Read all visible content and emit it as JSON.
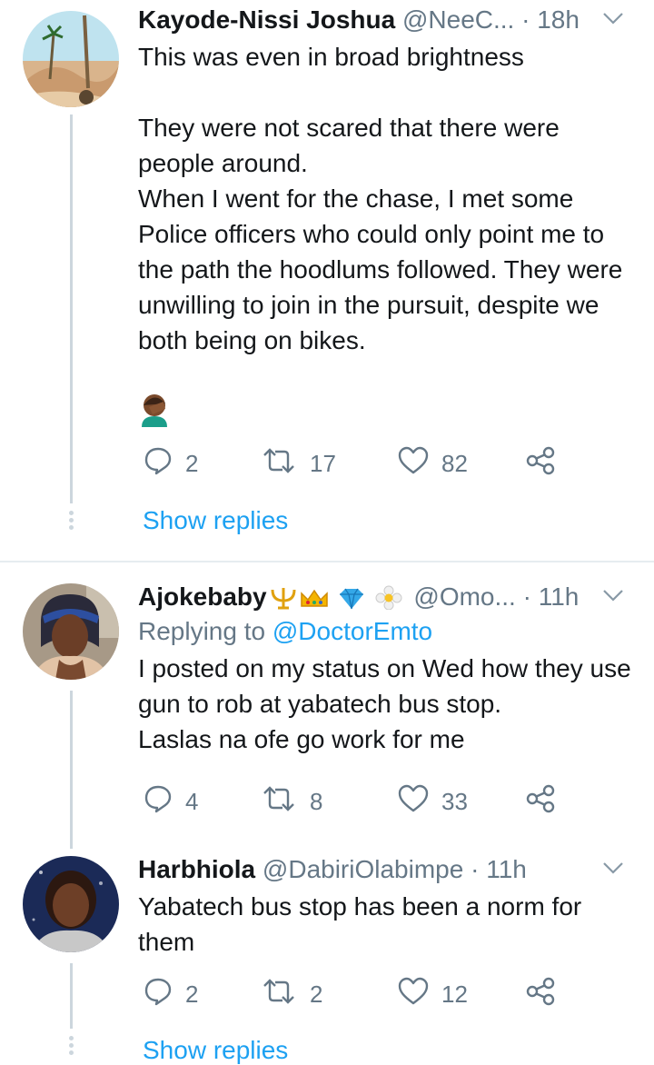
{
  "tweets": [
    {
      "name": "Kayode-Nissi Joshua",
      "handle": "@NeeC...",
      "time": "· 18h",
      "text": "This was even in broad brightness\n\nThey were not scared that there were people around.\nWhen I went for the chase, I met some Police officers who could only point me to the path the hoodlums followed. They were unwilling to join in the pursuit, despite we both being on bikes.",
      "replies": "2",
      "retweets": "17",
      "likes": "82",
      "show_replies": "Show replies"
    },
    {
      "name": "Ajokebaby",
      "handle": "@Omo...",
      "time": "· 11h",
      "replying_prefix": "Replying to",
      "replying_to": "@DoctorEmto",
      "text": "I posted on my status on Wed how they use gun to rob at yabatech bus stop.\nLaslas na ofe go work for me",
      "replies": "4",
      "retweets": "8",
      "likes": "33"
    },
    {
      "name": "Harbhiola",
      "handle": "@DabiriOlabimpe",
      "time": "· 11h",
      "text": "Yabatech bus stop has been a norm for them",
      "replies": "2",
      "retweets": "2",
      "likes": "12",
      "show_replies": "Show replies"
    }
  ],
  "colors": {
    "link": "#1da1f2",
    "muted": "#657786",
    "thread_line": "#ccd6dd",
    "divider": "#e6ecf0"
  },
  "icons": [
    "reply-icon",
    "retweet-icon",
    "like-icon",
    "share-icon",
    "chevron-down-icon",
    "facepalm-emoji"
  ]
}
